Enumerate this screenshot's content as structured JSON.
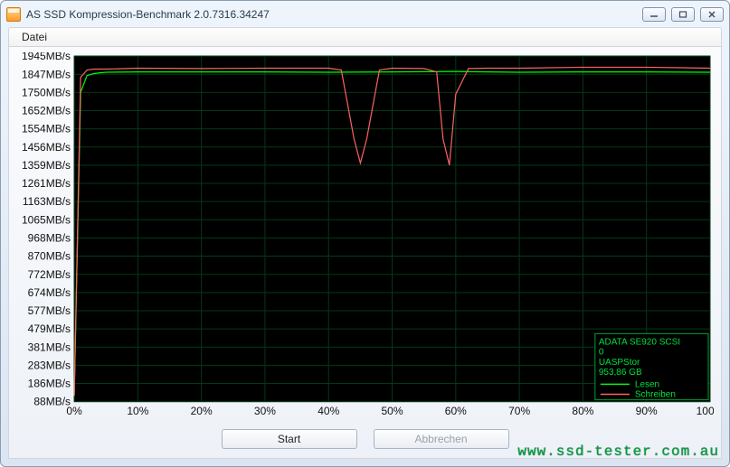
{
  "window": {
    "title": "AS SSD Kompression-Benchmark 2.0.7316.34247"
  },
  "menu": {
    "file": "Datei"
  },
  "buttons": {
    "start": "Start",
    "cancel": "Abbrechen"
  },
  "watermark": "www.ssd-tester.com.au",
  "legend": {
    "device": "ADATA SE920 SCSI",
    "device_line2": "0",
    "driver": "UASPStor",
    "capacity": "953,86 GB",
    "read": "Lesen",
    "write": "Schreiben"
  },
  "chart_data": {
    "type": "line",
    "xlabel": "",
    "ylabel": "",
    "xlim": [
      0,
      100
    ],
    "ylim": [
      88,
      1945
    ],
    "x_ticks": [
      "0%",
      "10%",
      "20%",
      "30%",
      "40%",
      "50%",
      "60%",
      "70%",
      "80%",
      "90%",
      "100%"
    ],
    "y_ticks": [
      "1945MB/s",
      "1847MB/s",
      "1750MB/s",
      "1652MB/s",
      "1554MB/s",
      "1456MB/s",
      "1359MB/s",
      "1261MB/s",
      "1163MB/s",
      "1065MB/s",
      "968MB/s",
      "870MB/s",
      "772MB/s",
      "674MB/s",
      "577MB/s",
      "479MB/s",
      "381MB/s",
      "283MB/s",
      "186MB/s",
      "88MB/s"
    ],
    "series": [
      {
        "name": "Lesen",
        "color": "#00ff00",
        "x": [
          0,
          1,
          2,
          3,
          4,
          5,
          10,
          20,
          30,
          40,
          50,
          60,
          70,
          80,
          90,
          100
        ],
        "y": [
          120,
          1750,
          1840,
          1850,
          1855,
          1858,
          1860,
          1860,
          1860,
          1858,
          1860,
          1862,
          1858,
          1860,
          1860,
          1858
        ]
      },
      {
        "name": "Schreiben",
        "color": "#ff6262",
        "x": [
          0,
          1,
          2,
          3,
          4,
          5,
          10,
          20,
          30,
          40,
          42,
          44,
          45,
          46,
          48,
          50,
          55,
          57,
          58,
          59,
          60,
          62,
          65,
          70,
          80,
          90,
          100
        ],
        "y": [
          120,
          1830,
          1870,
          1875,
          1875,
          1875,
          1880,
          1878,
          1880,
          1880,
          1870,
          1500,
          1370,
          1500,
          1870,
          1880,
          1878,
          1860,
          1500,
          1359,
          1740,
          1878,
          1880,
          1880,
          1885,
          1885,
          1880
        ]
      }
    ]
  }
}
